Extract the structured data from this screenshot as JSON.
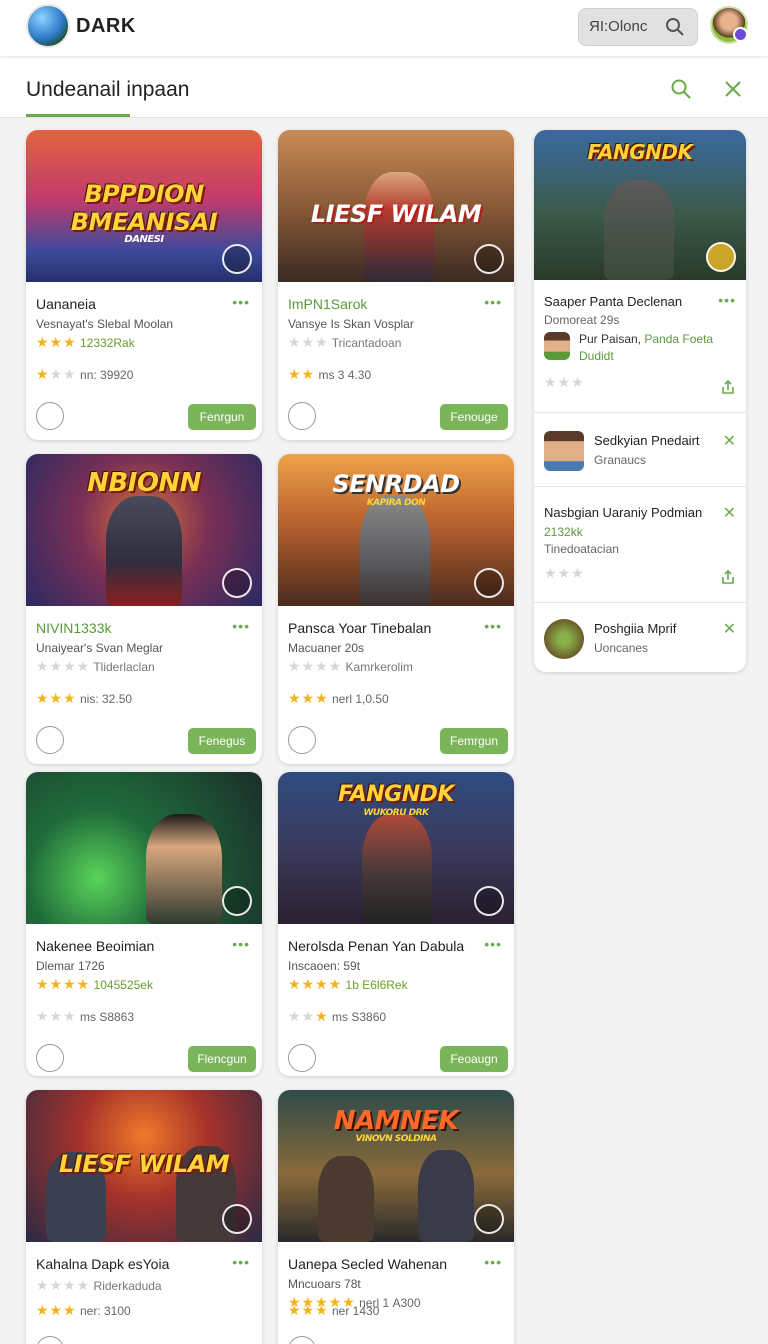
{
  "header": {
    "brand": "DARK",
    "search_value": "ЯI:Olonc",
    "icons": {
      "search": "search-icon",
      "avatar": "user-avatar"
    }
  },
  "subbar": {
    "title": "Undeanail inpaan",
    "icons": [
      "search-icon",
      "close-icon"
    ]
  },
  "accent": "#6aaa4a",
  "cards": [
    {
      "art_title": "BPPDION BMEANISAI",
      "art_caption": "DANESI",
      "title": "Uananeia",
      "title_green": false,
      "subtitle": "Vesnayat's Slebal Moolan",
      "rating_text": "12332Rak",
      "rating_stars": 3,
      "line": "nn: 39920",
      "line_stars": 1,
      "button": "Fenrgun"
    },
    {
      "art_title": "LIESF WILAM",
      "art_caption": "",
      "title": "ImPN1Sarok",
      "title_green": true,
      "subtitle": "Vansye Is Skan Vosplar",
      "rating_text": "Tricantadoan",
      "rating_stars": 0,
      "line": "ms 3 4.30",
      "line_stars": 2,
      "button": "Fenouge"
    },
    {
      "art_title": "NBIONN",
      "art_caption": "",
      "title": "NIVIN1333k",
      "title_green": true,
      "subtitle": "Unaiyear's Svan Meglar",
      "rating_text": "Tliderlaclan",
      "rating_stars": 0,
      "line": "nis: 32.50",
      "line_stars": 3,
      "button": "Fenegus"
    },
    {
      "art_title": "SENRDAD",
      "art_caption": "KAPIRA DON",
      "title": "Pansca Yoar Tinebalan",
      "title_green": false,
      "subtitle": "Macuaner 20s",
      "rating_text": "Kamrkerolim",
      "rating_stars": 0,
      "line": "nerl 1,0.50",
      "line_stars": 3,
      "button": "Femrgun"
    },
    {
      "art_title": "",
      "art_caption": "",
      "title": "Nakenee Beoimian",
      "title_green": false,
      "subtitle": "Dlemar 1726",
      "rating_text": "1045525ek",
      "rating_stars": 4,
      "line": "ms S8863",
      "line_stars": 1,
      "button": "Flencgun"
    },
    {
      "art_title": "FANGNDK",
      "art_caption": "WUKORU DRK",
      "title": "Nerolsda Penan Yan Dabula",
      "title_green": false,
      "subtitle": "Inscaoen: 59t",
      "rating_text": "1b E6l6Rek",
      "rating_stars": 4,
      "line": "ms S3860",
      "line_stars": 2,
      "button": "Feoaugn"
    },
    {
      "art_title": "LIESF WILAM",
      "art_caption": "",
      "title": "Kahalna Dapk esYoia",
      "title_green": false,
      "subtitle": "Riderkaduda",
      "rating_text": "",
      "rating_stars": 0,
      "line": "ner: 3100",
      "line_stars": 3,
      "button": ""
    },
    {
      "art_title": "NAMNEK",
      "art_caption": "VINOVN SOLDINA",
      "title": "Uanepa Secled Wahenan",
      "title_green": false,
      "subtitle": "Mncuoars 78t",
      "rating_text": "nerl 1 A300",
      "rating_stars": 5,
      "line": "ner 1430",
      "line_stars": 3,
      "button": ""
    }
  ],
  "side": {
    "feature": {
      "art_title": "FANGNDK",
      "title": "Saaper Panta Declenan",
      "meta": "Domoreat 29s",
      "author": "Pur Paisan",
      "author_link": "Panda Foeta",
      "author_sub": "Dudidt"
    },
    "items": [
      {
        "title": "Sedkyian Pnedairt",
        "sub": "Granaucs"
      },
      {
        "title": "Nasbgian Uaraniy Podmian",
        "rating": "2132kk",
        "sub": "Tinedoatacian"
      },
      {
        "title": "Poshgiia Mprif",
        "sub": "Uoncanes"
      }
    ]
  }
}
